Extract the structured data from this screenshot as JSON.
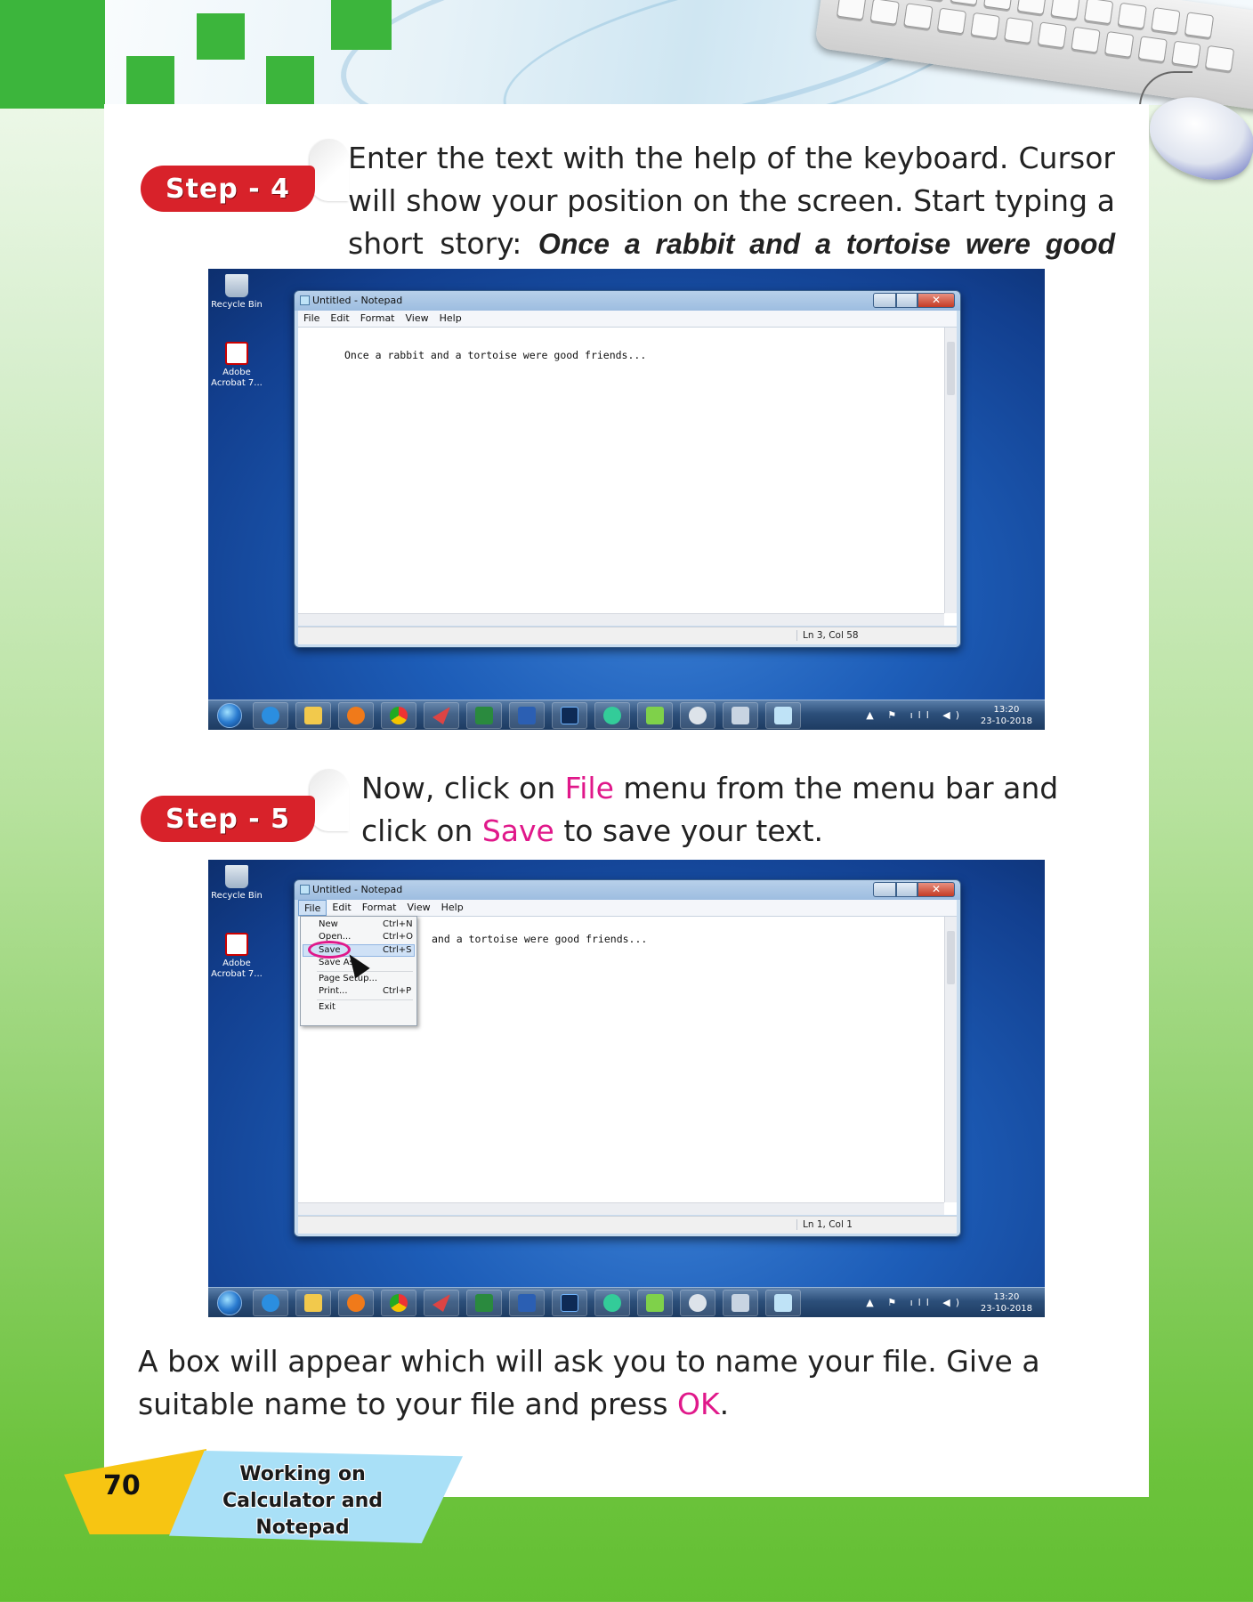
{
  "step4": {
    "badge": "Step - 4",
    "text_before": "Enter the text with the help of the keyboard. Cursor will show your position on the screen. Start typing a short story: ",
    "text_italic": "Once a rabbit and a tortoise were good friends . . ."
  },
  "step5": {
    "badge": "Step - 5",
    "t1": "Now, click on ",
    "file": "File",
    "t2": " menu from the menu bar and click on ",
    "save": "Save",
    "t3": " to save your text."
  },
  "final_para": {
    "t1": "A box will appear which will ask you to name your file. Give a suitable name to your file and press ",
    "ok": "OK",
    "t2": "."
  },
  "footer": {
    "page_number": "70",
    "chapter_line1": "Working on",
    "chapter_line2": "Calculator and Notepad"
  },
  "desktop": {
    "recycle_bin": "Recycle Bin",
    "adobe": "Adobe Acrobat 7...",
    "window_title": "Untitled - Notepad",
    "close_glyph": "✕",
    "menu": [
      "File",
      "Edit",
      "Format",
      "View",
      "Help"
    ],
    "tray_time_1": "13:20",
    "tray_time_2": "13:20",
    "tray_date": "23-10-2018",
    "tray_icons": "▲ ⚑ ıll ◀)"
  },
  "screenshot1": {
    "typed_text": "Once a rabbit and a tortoise were good friends...",
    "status": "Ln 3, Col 58"
  },
  "screenshot2": {
    "typed_text": "and a tortoise were good friends...",
    "status": "Ln 1, Col 1",
    "file_menu": [
      {
        "label": "New",
        "shortcut": "Ctrl+N"
      },
      {
        "label": "Open...",
        "shortcut": "Ctrl+O"
      },
      {
        "label": "Save",
        "shortcut": "Ctrl+S"
      },
      {
        "label": "Save As...",
        "shortcut": ""
      },
      {
        "label": "Page Setup...",
        "shortcut": ""
      },
      {
        "label": "Print...",
        "shortcut": "Ctrl+P"
      },
      {
        "label": "Exit",
        "shortcut": ""
      }
    ]
  },
  "colors": {
    "accent_pink": "#e0188a",
    "badge_red": "#d8222a",
    "page_green": "#63bf33"
  }
}
